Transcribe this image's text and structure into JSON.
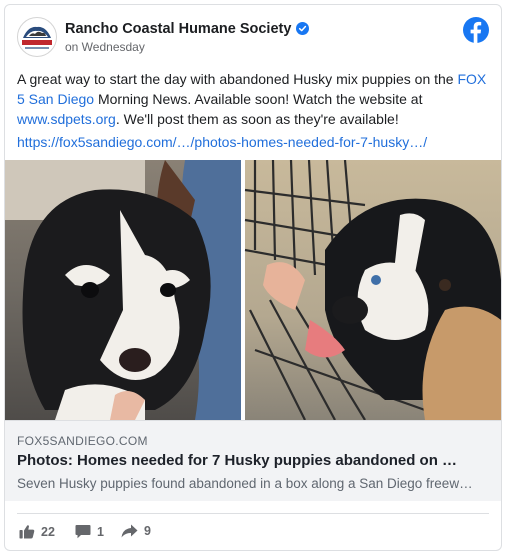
{
  "post": {
    "page_name": "Rancho Coastal Humane Society",
    "time": "on Wednesday",
    "text_before_link1": "A great way to start the day with abandoned Husky mix puppies on the ",
    "link1": "FOX 5 San Diego",
    "text_between": " Morning News. Available soon! Watch the website at ",
    "link2": "www.sdpets.org",
    "text_after": ". We'll post them as soon as they're available!",
    "url": "https://fox5sandiego.com/…/photos-homes-needed-for-7-husky…/"
  },
  "avatar": {
    "line1": "RANCHO COASTAL",
    "line2": "HUMANE SOCIETY"
  },
  "link_preview": {
    "domain": "FOX5SANDIEGO.COM",
    "headline": "Photos: Homes needed for 7 Husky puppies abandoned on …",
    "description": "Seven Husky puppies found abandoned in a box along a San Diego freew…"
  },
  "stats": {
    "likes": "22",
    "comments": "1",
    "shares": "9"
  },
  "colors": {
    "brand_blue": "#1877f2",
    "link": "#216fdb",
    "muted": "#65676b"
  },
  "icons": [
    "verified-badge-icon",
    "facebook-logo-icon",
    "like-icon",
    "comment-icon",
    "share-icon"
  ]
}
